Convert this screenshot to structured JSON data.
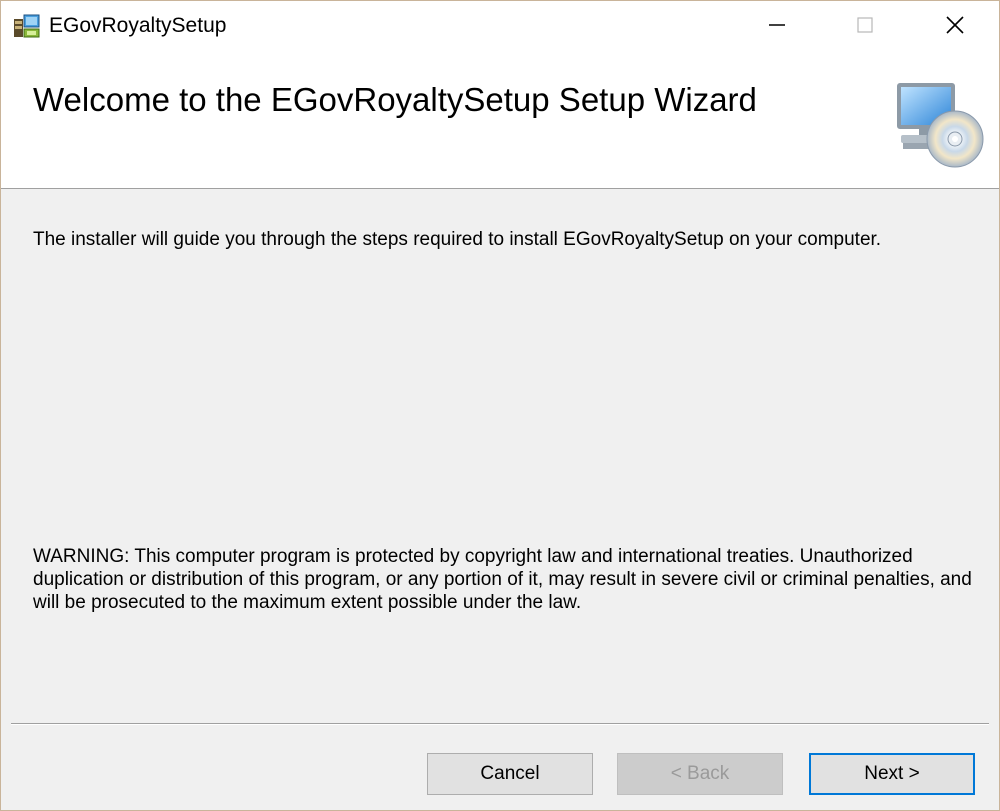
{
  "window": {
    "title": "EGovRoyaltySetup",
    "app_icon": "installer-icon",
    "caption_buttons": [
      "minimize-icon",
      "maximize-icon",
      "close-icon"
    ]
  },
  "header": {
    "title": "Welcome to the EGovRoyaltySetup Setup Wizard",
    "icon": "computer-cd-icon"
  },
  "body": {
    "intro": "The installer will guide you through the steps required to install EGovRoyaltySetup on your computer.",
    "warning": "WARNING: This computer program is protected by copyright law and international treaties. Unauthorized duplication or distribution of this program, or any portion of it, may result in severe civil or criminal penalties, and will be prosecuted to the maximum extent possible under the law."
  },
  "buttons": {
    "cancel": "Cancel",
    "back": "< Back",
    "next": "Next >"
  },
  "colors": {
    "window_bg": "#f0f0f0",
    "header_bg": "#ffffff",
    "focus_accent": "#0078d7"
  }
}
